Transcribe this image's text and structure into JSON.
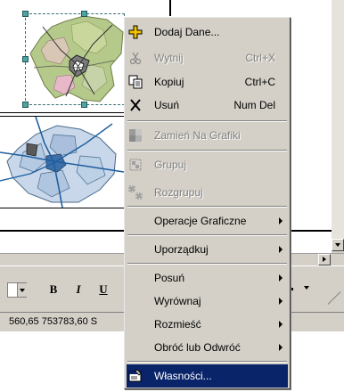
{
  "toolbar": {
    "bold_label": "B",
    "italic_label": "I",
    "underline_label": "U"
  },
  "status": {
    "coordinates": "560,65 753783,60 S"
  },
  "menu": {
    "items": [
      {
        "label": "Dodaj Dane...",
        "shortcut": "",
        "icon": "add-data-icon",
        "enabled": true
      },
      {
        "label": "Wytnij",
        "shortcut": "Ctrl+X",
        "icon": "scissors-icon",
        "enabled": false
      },
      {
        "label": "Kopiuj",
        "shortcut": "Ctrl+C",
        "icon": "copy-icon",
        "enabled": true
      },
      {
        "label": "Usuń",
        "shortcut": "Num Del",
        "icon": "delete-x-icon",
        "enabled": true
      },
      {
        "label": "Zamień Na Grafiki",
        "shortcut": "",
        "icon": "convert-graphics-icon",
        "enabled": false
      },
      {
        "label": "Grupuj",
        "shortcut": "",
        "icon": "group-icon",
        "enabled": false
      },
      {
        "label": "Rozgrupuj",
        "shortcut": "",
        "icon": "ungroup-icon",
        "enabled": false
      },
      {
        "label": "Operacje Graficzne",
        "shortcut": "",
        "icon": "",
        "enabled": true,
        "submenu": true
      },
      {
        "label": "Uporządkuj",
        "shortcut": "",
        "icon": "",
        "enabled": true,
        "submenu": true
      },
      {
        "label": "Posuń",
        "shortcut": "",
        "icon": "",
        "enabled": true,
        "submenu": true
      },
      {
        "label": "Wyrównaj",
        "shortcut": "",
        "icon": "",
        "enabled": true,
        "submenu": true
      },
      {
        "label": "Rozmieść",
        "shortcut": "",
        "icon": "",
        "enabled": true,
        "submenu": true
      },
      {
        "label": "Obróć lub Odwróć",
        "shortcut": "",
        "icon": "",
        "enabled": true,
        "submenu": true
      },
      {
        "label": "Własności...",
        "shortcut": "",
        "icon": "properties-icon",
        "enabled": true,
        "highlighted": true
      }
    ]
  },
  "colors": {
    "menu_bg": "#d4d0c8",
    "highlight": "#0a246a",
    "selection_handle": "#4fa3a3"
  }
}
